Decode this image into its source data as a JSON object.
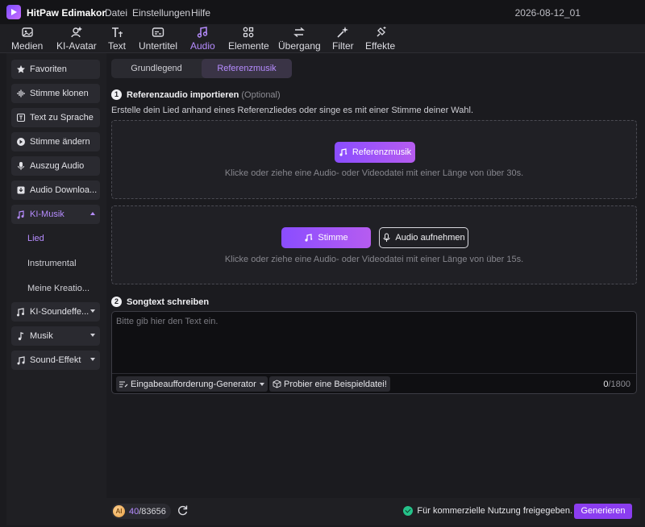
{
  "titlebar": {
    "app_name": "HitPaw Edimakor",
    "menu": [
      "Datei",
      "Einstellungen",
      "Hilfe"
    ],
    "project": "2026-08-12_01"
  },
  "toolbar": {
    "items": [
      {
        "label": "Medien",
        "icon": "media-icon"
      },
      {
        "label": "KI-Avatar",
        "icon": "avatar-icon"
      },
      {
        "label": "Text",
        "icon": "text-icon"
      },
      {
        "label": "Untertitel",
        "icon": "subtitle-icon"
      },
      {
        "label": "Audio",
        "icon": "audio-icon",
        "active": true
      },
      {
        "label": "Elemente",
        "icon": "elements-icon"
      },
      {
        "label": "Übergang",
        "icon": "transition-icon"
      },
      {
        "label": "Filter",
        "icon": "filter-icon"
      },
      {
        "label": "Effekte",
        "icon": "effects-icon"
      }
    ]
  },
  "sidebar": {
    "items": [
      {
        "label": "Favoriten",
        "icon": "star-icon"
      },
      {
        "label": "Stimme klonen",
        "icon": "waveform-icon"
      },
      {
        "label": "Text zu Sprache",
        "icon": "text-speech-icon"
      },
      {
        "label": "Stimme ändern",
        "icon": "voice-change-icon"
      },
      {
        "label": "Auszug Audio",
        "icon": "microphone-icon"
      },
      {
        "label": "Audio Downloa...",
        "icon": "download-icon"
      },
      {
        "label": "KI-Musik",
        "icon": "ai-music-icon",
        "expanded": true
      },
      {
        "label": "KI-Soundeffe...",
        "icon": "ai-sound-icon"
      },
      {
        "label": "Musik",
        "icon": "music-note-icon"
      },
      {
        "label": "Sound-Effekt",
        "icon": "sound-effect-icon"
      }
    ],
    "sub_items": [
      "Lied",
      "Instrumental",
      "Meine Kreatio..."
    ],
    "active_sub": "Lied"
  },
  "tabs": [
    "Grundlegend",
    "Referenzmusik"
  ],
  "active_tab": "Referenzmusik",
  "section1": {
    "number": "1",
    "title": "Referenzaudio importieren",
    "optional": "(Optional)",
    "description": "Erstelle dein Lied anhand eines Referenzliedes oder singe es mit einer Stimme deiner Wahl."
  },
  "dropzone_ref": {
    "button": "Referenzmusik",
    "hint": "Klicke oder ziehe eine Audio- oder Videodatei mit einer Länge von über 30s."
  },
  "dropzone_voice": {
    "button": "Stimme",
    "record_button": "Audio aufnehmen",
    "hint": "Klicke oder ziehe eine Audio- oder Videodatei mit einer Länge von über 15s."
  },
  "section2": {
    "number": "2",
    "title": "Songtext schreiben"
  },
  "lyrics": {
    "placeholder": "Bitte gib hier den Text ein.",
    "generator": "Eingabeaufforderung-Generator",
    "example": "Probier eine Beispieldatei!",
    "count": "0",
    "max": "/1800"
  },
  "footer": {
    "credits_used": "40",
    "credits_total": "/83656",
    "commercial": "Für kommerzielle Nutzung freigegeben.",
    "generate": "Generieren"
  },
  "colors": {
    "accent": "#b68cff",
    "button_gradient_start": "#8a4dff",
    "button_gradient_end": "#b65cf0",
    "generate": "#8b3df0",
    "success": "#25c28a"
  }
}
